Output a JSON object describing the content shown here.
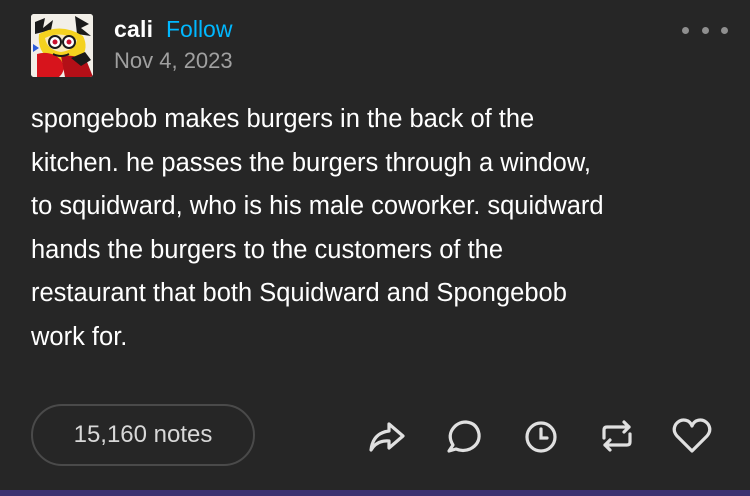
{
  "post": {
    "author": "cali",
    "follow_label": "Follow",
    "date": "Nov 4, 2023",
    "body": "spongebob makes burgers in the back of the\nkitchen. he passes the burgers through a window,\nto squidward, who is his male coworker. squidward\nhands the burgers to the customers of the\nrestaurant that both Squidward and Spongebob\nwork for.",
    "notes_label": "15,160 notes"
  },
  "icons": {
    "more": "more-options-icon",
    "share": "share-icon",
    "reply": "reply-icon",
    "queue": "clock-icon",
    "reblog": "reblog-icon",
    "like": "heart-icon"
  },
  "colors": {
    "background": "#262626",
    "follow": "#00b8ff",
    "secondary_text": "#a0a0a0",
    "notes_border": "#4a4a4a",
    "icon": "#e0e0e0"
  }
}
